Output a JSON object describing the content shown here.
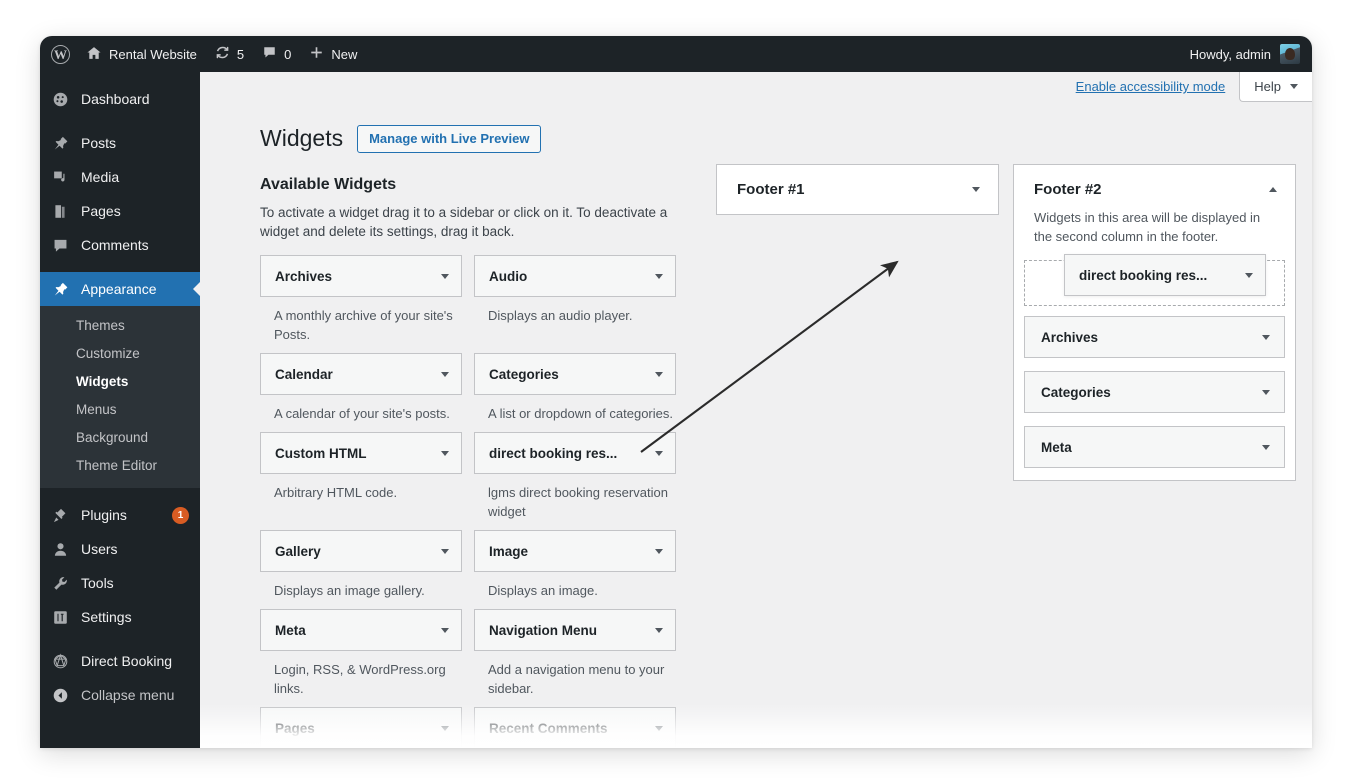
{
  "adminbar": {
    "logo_icon": "wordpress-logo-icon",
    "site_icon": "home-icon",
    "site_name": "Rental Website",
    "updates_icon": "updates-icon",
    "updates_count": "5",
    "comments_icon": "comment-bubble-icon",
    "comments_count": "0",
    "new_icon": "plus-icon",
    "new_label": "New",
    "account_label": "Howdy, admin",
    "avatar_icon": "avatar"
  },
  "sidebar": {
    "items": [
      {
        "label": "Dashboard",
        "icon": "dashboard-icon",
        "key": "dashboard"
      },
      {
        "label": "Posts",
        "icon": "pin-icon",
        "key": "posts"
      },
      {
        "label": "Media",
        "icon": "media-icon",
        "key": "media"
      },
      {
        "label": "Pages",
        "icon": "pages-icon",
        "key": "pages"
      },
      {
        "label": "Comments",
        "icon": "comment-bubble-icon",
        "key": "comments"
      },
      {
        "label": "Appearance",
        "icon": "appearance-brush-icon",
        "key": "appearance",
        "current": true
      }
    ],
    "submenu": [
      {
        "label": "Themes",
        "key": "themes"
      },
      {
        "label": "Customize",
        "key": "customize"
      },
      {
        "label": "Widgets",
        "key": "widgets",
        "current": true
      },
      {
        "label": "Menus",
        "key": "menus"
      },
      {
        "label": "Background",
        "key": "background"
      },
      {
        "label": "Theme Editor",
        "key": "theme-editor"
      }
    ],
    "items2": [
      {
        "label": "Plugins",
        "icon": "plugin-icon",
        "key": "plugins",
        "badge": "1"
      },
      {
        "label": "Users",
        "icon": "users-icon",
        "key": "users"
      },
      {
        "label": "Tools",
        "icon": "wrench-icon",
        "key": "tools"
      },
      {
        "label": "Settings",
        "icon": "settings-sliders-icon",
        "key": "settings"
      }
    ],
    "items3": [
      {
        "label": "Direct Booking",
        "icon": "direct-booking-icon",
        "key": "direct-booking"
      }
    ],
    "collapse": {
      "label": "Collapse menu",
      "icon": "collapse-arrow-icon"
    },
    "accent_color": "#2271b1",
    "badge_color": "#d85c23"
  },
  "topbar": {
    "accessibility_link": "Enable accessibility mode",
    "help_label": "Help",
    "help_caret": "chevron-down-icon"
  },
  "header": {
    "title": "Widgets",
    "live_preview_label": "Manage with Live Preview"
  },
  "available": {
    "title": "Available Widgets",
    "description": "To activate a widget drag it to a sidebar or click on it. To deactivate a widget and delete its settings, drag it back.",
    "widgets": [
      {
        "title": "Archives",
        "desc": "A monthly archive of your site's Posts."
      },
      {
        "title": "Audio",
        "desc": "Displays an audio player."
      },
      {
        "title": "Calendar",
        "desc": "A calendar of your site's posts."
      },
      {
        "title": "Categories",
        "desc": "A list or dropdown of categories."
      },
      {
        "title": "Custom HTML",
        "desc": "Arbitrary HTML code."
      },
      {
        "title": "direct booking res...",
        "desc": "lgms direct booking reservation widget"
      },
      {
        "title": "Gallery",
        "desc": "Displays an image gallery."
      },
      {
        "title": "Image",
        "desc": "Displays an image."
      },
      {
        "title": "Meta",
        "desc": "Login, RSS, & WordPress.org links."
      },
      {
        "title": "Navigation Menu",
        "desc": "Add a navigation menu to your sidebar."
      },
      {
        "title": "Pages",
        "desc": ""
      },
      {
        "title": "Recent Comments",
        "desc": ""
      }
    ]
  },
  "sidebars": {
    "footer1": {
      "title": "Footer #1",
      "toggle_icon": "chevron-down-icon",
      "expanded": false
    },
    "footer2": {
      "title": "Footer #2",
      "description": "Widgets in this area will be displayed in the second column in the footer.",
      "toggle_icon": "chevron-up-icon",
      "expanded": true,
      "widgets": [
        {
          "title": "Archives"
        },
        {
          "title": "Categories"
        },
        {
          "title": "Meta"
        }
      ]
    }
  },
  "drag": {
    "title": "direct booking res...",
    "toggle_icon": "chevron-down-icon"
  },
  "annotation": {
    "arrow_color": "#2b2b2b"
  }
}
